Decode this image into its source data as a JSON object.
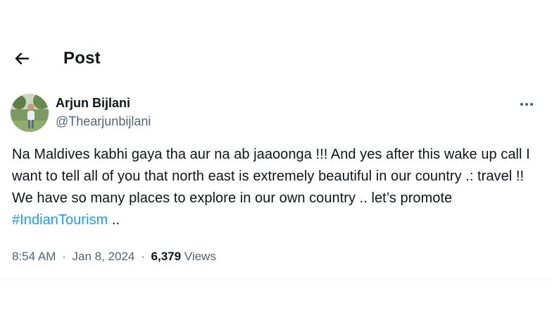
{
  "header": {
    "title": "Post"
  },
  "author": {
    "name": "Arjun Bijlani",
    "handle": "@Thearjunbijlani"
  },
  "tweet": {
    "text_before": "Na Maldives kabhi gaya tha aur na ab jaaoonga !!! And yes after this wake up call I want to tell all of you that north east is extremely beautiful in our country .: travel !! We have so many places to explore in our own country .. let’s promote ",
    "hashtag": "#IndianTourism",
    "text_after": " .."
  },
  "meta": {
    "time": "8:54 AM",
    "separator": "·",
    "date": "Jan 8, 2024",
    "views_count": "6,379",
    "views_label": "Views"
  },
  "icons": {
    "back": "arrow-left-icon",
    "more": "more-horizontal-icon"
  },
  "colors": {
    "text": "#0f1419",
    "secondary": "#536471",
    "link": "#1d9bf0",
    "background": "#ffffff"
  }
}
